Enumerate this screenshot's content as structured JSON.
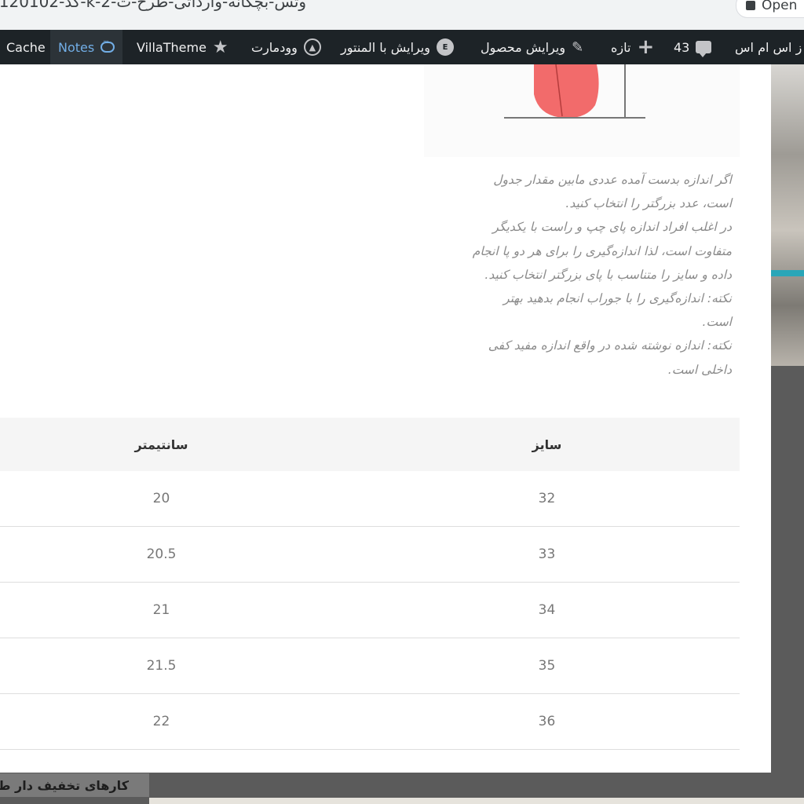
{
  "browser": {
    "url_fragment": "/کد-120102-k-2-وتس-بچگانه-وارداتی-طرح-ت",
    "open_button_label": "Open"
  },
  "admin_bar": {
    "cache_label": "Cache",
    "notes_label": "Notes",
    "villatheme_label": "VillaTheme",
    "woodmart_label": "وودمارت",
    "elementor_label": "ویرایش با المنتور",
    "edit_product_label": "ویرایش محصول",
    "new_label": "تازه",
    "comments_count": "43",
    "site_label": "ز اس ام اس"
  },
  "description": {
    "lines": [
      "اگر اندازه بدست آمده عددی مابین مقدار جدول",
      "است، عدد بزرگتر را انتخاب کنید.",
      "در اغلب افراد اندازه پای چپ و راست با یکدیگر",
      "متفاوت است، لذا اندازه‌گیری را برای هر دو پا انجام",
      "داده و سایز را متناسب با پای بزرگتر انتخاب کنید.",
      "نکته: اندازه‌گیری را با جوراب انجام بدهید بهتر",
      "است.",
      "نکته: اندازه نوشته شده در واقع اندازه مفید کفی",
      "داخلی است."
    ]
  },
  "size_table": {
    "headers": [
      "سایز",
      "سانتیمتر"
    ],
    "rows": [
      [
        "32",
        "20"
      ],
      [
        "33",
        "20.5"
      ],
      [
        "34",
        "21"
      ],
      [
        "35",
        "21.5"
      ],
      [
        "36",
        "22"
      ]
    ]
  },
  "footer": {
    "discount_label": "کارهای تخفیف دار ط"
  },
  "colors": {
    "admin_bar_bg": "#1d2327",
    "notes_accent": "#72aee6",
    "foot_illustration": "#f26b6b"
  }
}
